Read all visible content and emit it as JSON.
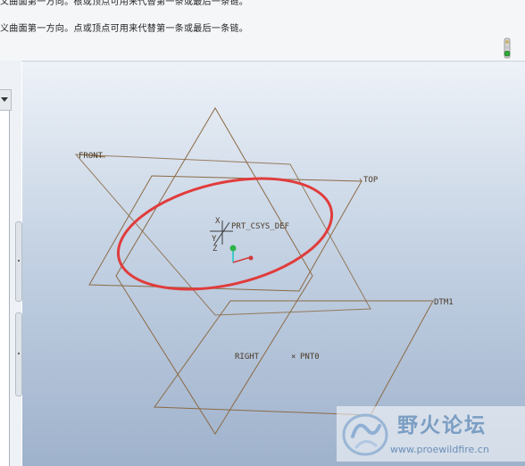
{
  "message_area": {
    "line1": "义曲面第一方向。根或顶点可用来代替第一条或最后一条链。",
    "line2": "义曲面第一方向。点或顶点可用来代替第一条或最后一条链。"
  },
  "viewport": {
    "datum_planes": [
      "FRONT",
      "TOP",
      "RIGHT",
      "DTM1"
    ],
    "csys_label": "PRT_CSYS_DEF",
    "axis_labels": [
      "X",
      "Y",
      "Z"
    ],
    "point_label": "PNT0",
    "point_marker": "×",
    "highlight_color": "#e03c3c"
  },
  "watermark": {
    "title": "野火论坛",
    "url": "www.proewildfire.cn"
  },
  "icons": {
    "status": "traffic-light-icon",
    "dropdown": "chevron-down-icon"
  }
}
